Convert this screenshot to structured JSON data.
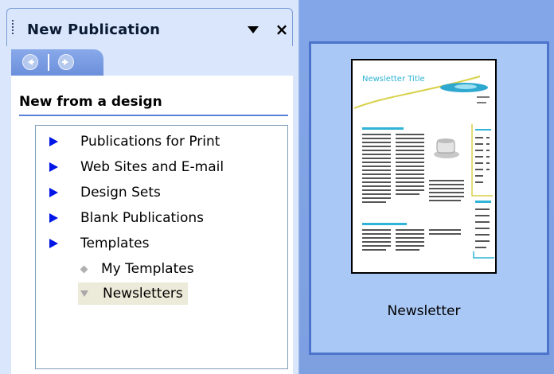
{
  "task_pane": {
    "title": "New Publication",
    "dropdown_icon": "triangle-down-icon",
    "close_icon": "close-icon",
    "close_glyph": "×",
    "nav": {
      "back_icon": "back-arrow-icon",
      "forward_icon": "forward-arrow-icon"
    },
    "section_heading": "New from a design",
    "tree": {
      "top_level": [
        {
          "label": "Publications for Print",
          "icon": "expand-arrow-icon"
        },
        {
          "label": "Web Sites and E-mail",
          "icon": "expand-arrow-icon"
        },
        {
          "label": "Design Sets",
          "icon": "expand-arrow-icon"
        },
        {
          "label": "Blank Publications",
          "icon": "expand-arrow-icon"
        },
        {
          "label": "Templates",
          "icon": "expand-arrow-icon"
        }
      ],
      "children": [
        {
          "label": "My Templates",
          "icon": "diamond-icon"
        },
        {
          "label": "Newsletters",
          "icon": "collapse-triangle-icon",
          "selected": true
        }
      ]
    }
  },
  "gallery": {
    "items": [
      {
        "label": "Newsletter",
        "thumbnail_title": "Newsletter Title"
      }
    ]
  },
  "colors": {
    "pane_bg": "#d9e6fb",
    "nav_bar": "#7a9be2",
    "accent_rule": "#5a7fd6",
    "tree_arrow": "#0016e6",
    "gallery_bg": "#aac8f5",
    "gallery_border": "#4c74cc",
    "selection_bg": "#ecead8"
  }
}
